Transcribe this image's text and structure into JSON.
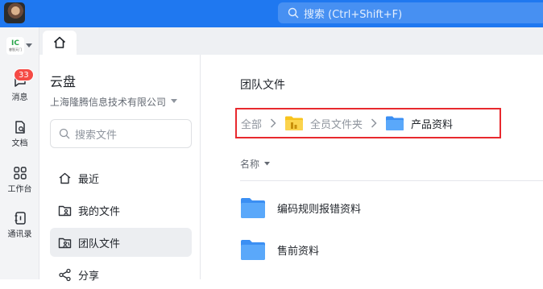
{
  "topbar": {
    "search_placeholder": "搜索 (Ctrl+Shift+F)",
    "accent_color": "#1f78f0"
  },
  "rail": {
    "org_logo_text": "IC",
    "org_logo_caption": "睿智天门",
    "items": [
      {
        "label": "消息",
        "icon": "chat-bubble-icon",
        "badge": "33"
      },
      {
        "label": "文档",
        "icon": "document-icon"
      },
      {
        "label": "工作台",
        "icon": "apps-grid-icon"
      },
      {
        "label": "通讯录",
        "icon": "contacts-icon"
      }
    ]
  },
  "tabs": {
    "home_icon": "home-icon"
  },
  "sidebar": {
    "title": "云盘",
    "org_name": "上海隆腾信息技术有限公司",
    "search_placeholder": "搜索文件",
    "items": [
      {
        "label": "最近",
        "icon": "home-outline-icon"
      },
      {
        "label": "我的文件",
        "icon": "user-folder-icon"
      },
      {
        "label": "团队文件",
        "icon": "team-folder-icon",
        "active": true
      },
      {
        "label": "分享",
        "icon": "share-icon"
      }
    ]
  },
  "main": {
    "title": "团队文件",
    "breadcrumb": [
      {
        "label": "全部"
      },
      {
        "label": "全员文件夹",
        "icon": "shared-folder-icon"
      },
      {
        "label": "产品资料",
        "icon": "folder-icon"
      }
    ],
    "column_name": "名称",
    "files": [
      {
        "name": "编码规则报错资料",
        "icon": "folder-icon"
      },
      {
        "name": "售前资料",
        "icon": "folder-icon"
      }
    ],
    "highlight_color": "#e8292e",
    "folder_color": "#4a9df8"
  }
}
